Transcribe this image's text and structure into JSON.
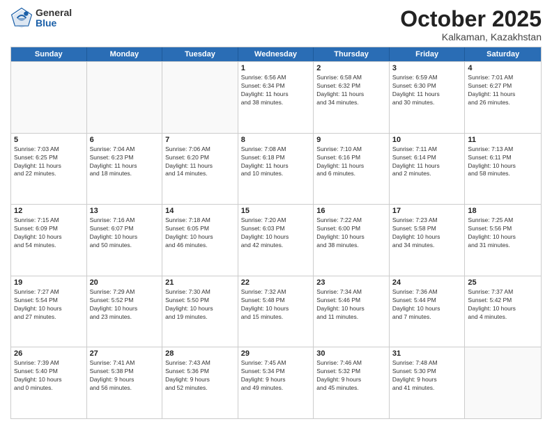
{
  "header": {
    "logo_general": "General",
    "logo_blue": "Blue",
    "month_title": "October 2025",
    "location": "Kalkaman, Kazakhstan"
  },
  "weekdays": [
    "Sunday",
    "Monday",
    "Tuesday",
    "Wednesday",
    "Thursday",
    "Friday",
    "Saturday"
  ],
  "rows": [
    [
      {
        "day": "",
        "lines": []
      },
      {
        "day": "",
        "lines": []
      },
      {
        "day": "",
        "lines": []
      },
      {
        "day": "1",
        "lines": [
          "Sunrise: 6:56 AM",
          "Sunset: 6:34 PM",
          "Daylight: 11 hours",
          "and 38 minutes."
        ]
      },
      {
        "day": "2",
        "lines": [
          "Sunrise: 6:58 AM",
          "Sunset: 6:32 PM",
          "Daylight: 11 hours",
          "and 34 minutes."
        ]
      },
      {
        "day": "3",
        "lines": [
          "Sunrise: 6:59 AM",
          "Sunset: 6:30 PM",
          "Daylight: 11 hours",
          "and 30 minutes."
        ]
      },
      {
        "day": "4",
        "lines": [
          "Sunrise: 7:01 AM",
          "Sunset: 6:27 PM",
          "Daylight: 11 hours",
          "and 26 minutes."
        ]
      }
    ],
    [
      {
        "day": "5",
        "lines": [
          "Sunrise: 7:03 AM",
          "Sunset: 6:25 PM",
          "Daylight: 11 hours",
          "and 22 minutes."
        ]
      },
      {
        "day": "6",
        "lines": [
          "Sunrise: 7:04 AM",
          "Sunset: 6:23 PM",
          "Daylight: 11 hours",
          "and 18 minutes."
        ]
      },
      {
        "day": "7",
        "lines": [
          "Sunrise: 7:06 AM",
          "Sunset: 6:20 PM",
          "Daylight: 11 hours",
          "and 14 minutes."
        ]
      },
      {
        "day": "8",
        "lines": [
          "Sunrise: 7:08 AM",
          "Sunset: 6:18 PM",
          "Daylight: 11 hours",
          "and 10 minutes."
        ]
      },
      {
        "day": "9",
        "lines": [
          "Sunrise: 7:10 AM",
          "Sunset: 6:16 PM",
          "Daylight: 11 hours",
          "and 6 minutes."
        ]
      },
      {
        "day": "10",
        "lines": [
          "Sunrise: 7:11 AM",
          "Sunset: 6:14 PM",
          "Daylight: 11 hours",
          "and 2 minutes."
        ]
      },
      {
        "day": "11",
        "lines": [
          "Sunrise: 7:13 AM",
          "Sunset: 6:11 PM",
          "Daylight: 10 hours",
          "and 58 minutes."
        ]
      }
    ],
    [
      {
        "day": "12",
        "lines": [
          "Sunrise: 7:15 AM",
          "Sunset: 6:09 PM",
          "Daylight: 10 hours",
          "and 54 minutes."
        ]
      },
      {
        "day": "13",
        "lines": [
          "Sunrise: 7:16 AM",
          "Sunset: 6:07 PM",
          "Daylight: 10 hours",
          "and 50 minutes."
        ]
      },
      {
        "day": "14",
        "lines": [
          "Sunrise: 7:18 AM",
          "Sunset: 6:05 PM",
          "Daylight: 10 hours",
          "and 46 minutes."
        ]
      },
      {
        "day": "15",
        "lines": [
          "Sunrise: 7:20 AM",
          "Sunset: 6:03 PM",
          "Daylight: 10 hours",
          "and 42 minutes."
        ]
      },
      {
        "day": "16",
        "lines": [
          "Sunrise: 7:22 AM",
          "Sunset: 6:00 PM",
          "Daylight: 10 hours",
          "and 38 minutes."
        ]
      },
      {
        "day": "17",
        "lines": [
          "Sunrise: 7:23 AM",
          "Sunset: 5:58 PM",
          "Daylight: 10 hours",
          "and 34 minutes."
        ]
      },
      {
        "day": "18",
        "lines": [
          "Sunrise: 7:25 AM",
          "Sunset: 5:56 PM",
          "Daylight: 10 hours",
          "and 31 minutes."
        ]
      }
    ],
    [
      {
        "day": "19",
        "lines": [
          "Sunrise: 7:27 AM",
          "Sunset: 5:54 PM",
          "Daylight: 10 hours",
          "and 27 minutes."
        ]
      },
      {
        "day": "20",
        "lines": [
          "Sunrise: 7:29 AM",
          "Sunset: 5:52 PM",
          "Daylight: 10 hours",
          "and 23 minutes."
        ]
      },
      {
        "day": "21",
        "lines": [
          "Sunrise: 7:30 AM",
          "Sunset: 5:50 PM",
          "Daylight: 10 hours",
          "and 19 minutes."
        ]
      },
      {
        "day": "22",
        "lines": [
          "Sunrise: 7:32 AM",
          "Sunset: 5:48 PM",
          "Daylight: 10 hours",
          "and 15 minutes."
        ]
      },
      {
        "day": "23",
        "lines": [
          "Sunrise: 7:34 AM",
          "Sunset: 5:46 PM",
          "Daylight: 10 hours",
          "and 11 minutes."
        ]
      },
      {
        "day": "24",
        "lines": [
          "Sunrise: 7:36 AM",
          "Sunset: 5:44 PM",
          "Daylight: 10 hours",
          "and 7 minutes."
        ]
      },
      {
        "day": "25",
        "lines": [
          "Sunrise: 7:37 AM",
          "Sunset: 5:42 PM",
          "Daylight: 10 hours",
          "and 4 minutes."
        ]
      }
    ],
    [
      {
        "day": "26",
        "lines": [
          "Sunrise: 7:39 AM",
          "Sunset: 5:40 PM",
          "Daylight: 10 hours",
          "and 0 minutes."
        ]
      },
      {
        "day": "27",
        "lines": [
          "Sunrise: 7:41 AM",
          "Sunset: 5:38 PM",
          "Daylight: 9 hours",
          "and 56 minutes."
        ]
      },
      {
        "day": "28",
        "lines": [
          "Sunrise: 7:43 AM",
          "Sunset: 5:36 PM",
          "Daylight: 9 hours",
          "and 52 minutes."
        ]
      },
      {
        "day": "29",
        "lines": [
          "Sunrise: 7:45 AM",
          "Sunset: 5:34 PM",
          "Daylight: 9 hours",
          "and 49 minutes."
        ]
      },
      {
        "day": "30",
        "lines": [
          "Sunrise: 7:46 AM",
          "Sunset: 5:32 PM",
          "Daylight: 9 hours",
          "and 45 minutes."
        ]
      },
      {
        "day": "31",
        "lines": [
          "Sunrise: 7:48 AM",
          "Sunset: 5:30 PM",
          "Daylight: 9 hours",
          "and 41 minutes."
        ]
      },
      {
        "day": "",
        "lines": []
      }
    ]
  ]
}
